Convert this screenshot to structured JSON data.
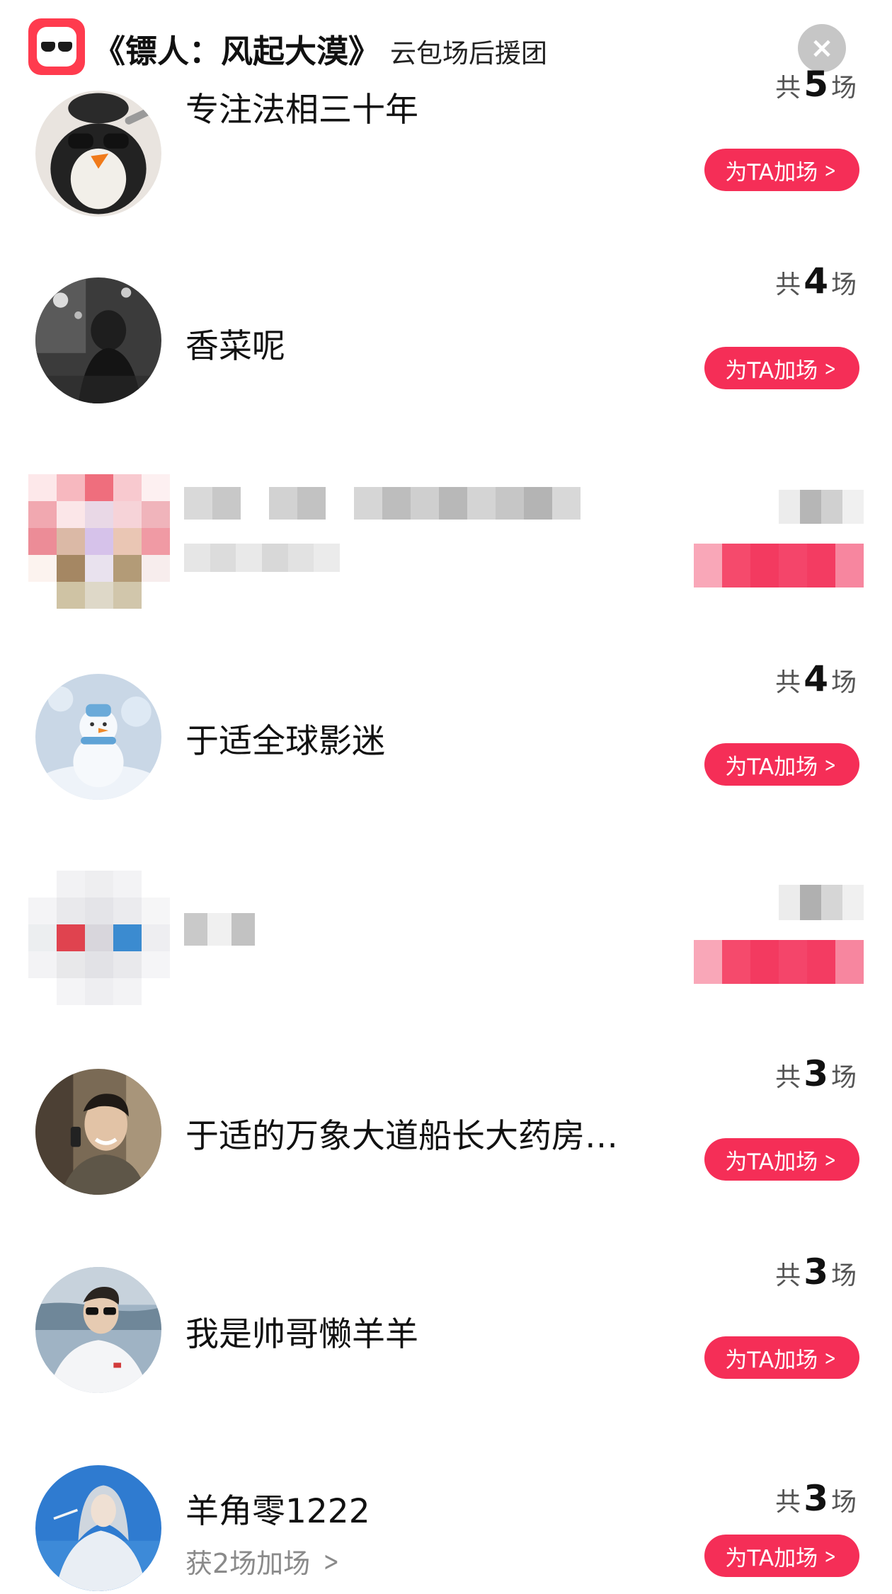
{
  "header": {
    "movie_title": "《镖人：风起大漠》",
    "subtitle": "云包场后援团"
  },
  "list": [
    {
      "name": "专注法相三十年",
      "count_prefix": "共",
      "count": "5",
      "count_suffix": "场",
      "button_label": "为TA加场",
      "avatar": "penguin-sunglasses-avatar"
    },
    {
      "name": "香菜呢",
      "count_prefix": "共",
      "count": "4",
      "count_suffix": "场",
      "button_label": "为TA加场",
      "avatar": "street-night-avatar"
    },
    {
      "name": "",
      "blurred": true,
      "avatar": "pixelated-avatar"
    },
    {
      "name": "于适全球影迷",
      "count_prefix": "共",
      "count": "4",
      "count_suffix": "场",
      "button_label": "为TA加场",
      "avatar": "snowman-avatar"
    },
    {
      "name": "",
      "blurred": true,
      "avatar": "pixelated-avatar"
    },
    {
      "name": "于适的万象大道船长大药房…",
      "count_prefix": "共",
      "count": "3",
      "count_suffix": "场",
      "button_label": "为TA加场",
      "avatar": "man-phone-avatar"
    },
    {
      "name": "我是帅哥懒羊羊",
      "count_prefix": "共",
      "count": "3",
      "count_suffix": "场",
      "button_label": "为TA加场",
      "avatar": "man-sunglasses-avatar"
    },
    {
      "name": "羊角零1222",
      "count_prefix": "共",
      "count": "3",
      "count_suffix": "场",
      "button_label": "为TA加场",
      "sub_text": "获2场加场",
      "avatar": "silver-hair-avatar"
    }
  ],
  "colors": {
    "accent": "#f52e57",
    "logo": "#ff3b4e",
    "close_bg": "#c6c6c6"
  }
}
